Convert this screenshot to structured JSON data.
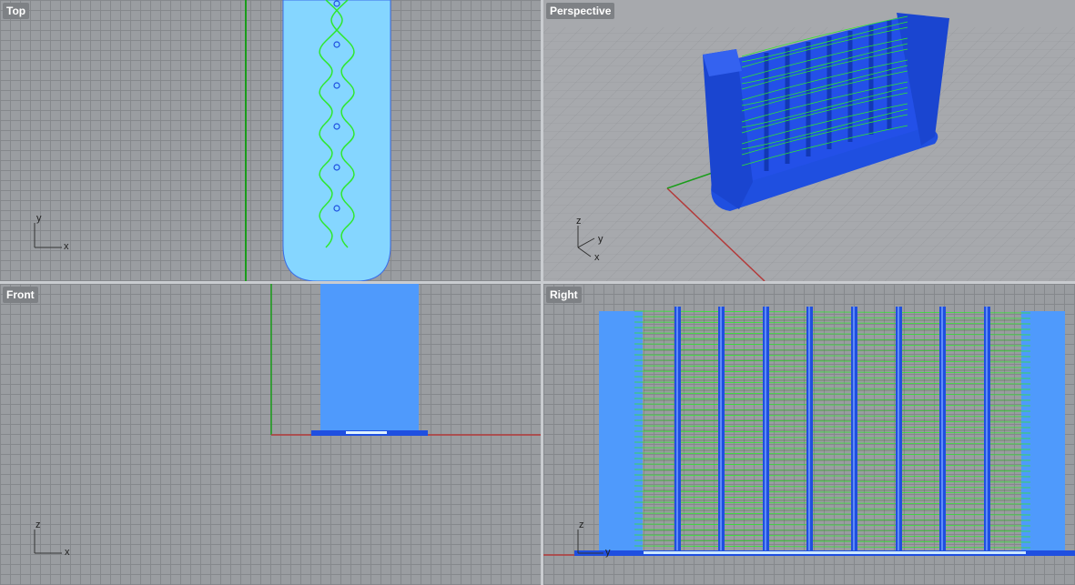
{
  "viewports": {
    "top": {
      "label": "Top",
      "axis_x": "x",
      "axis_y": "y"
    },
    "perspective": {
      "label": "Perspective",
      "axis_x": "x",
      "axis_y": "y",
      "axis_z": "z"
    },
    "front": {
      "label": "Front",
      "axis_x": "x",
      "axis_z": "z"
    },
    "right": {
      "label": "Right",
      "axis_y": "y",
      "axis_z": "z"
    }
  },
  "colors": {
    "grid_bg": "#9a9da1",
    "grid_line": "#85888c",
    "model_light": "#85d6ff",
    "model_mid": "#4f9afc",
    "model_dark": "#1f4fe0",
    "curve_green": "#2ee82e",
    "axis_red": "#b33a3a",
    "axis_green": "#1a9d1a"
  },
  "icons": [
    "axis-triad-icon"
  ]
}
